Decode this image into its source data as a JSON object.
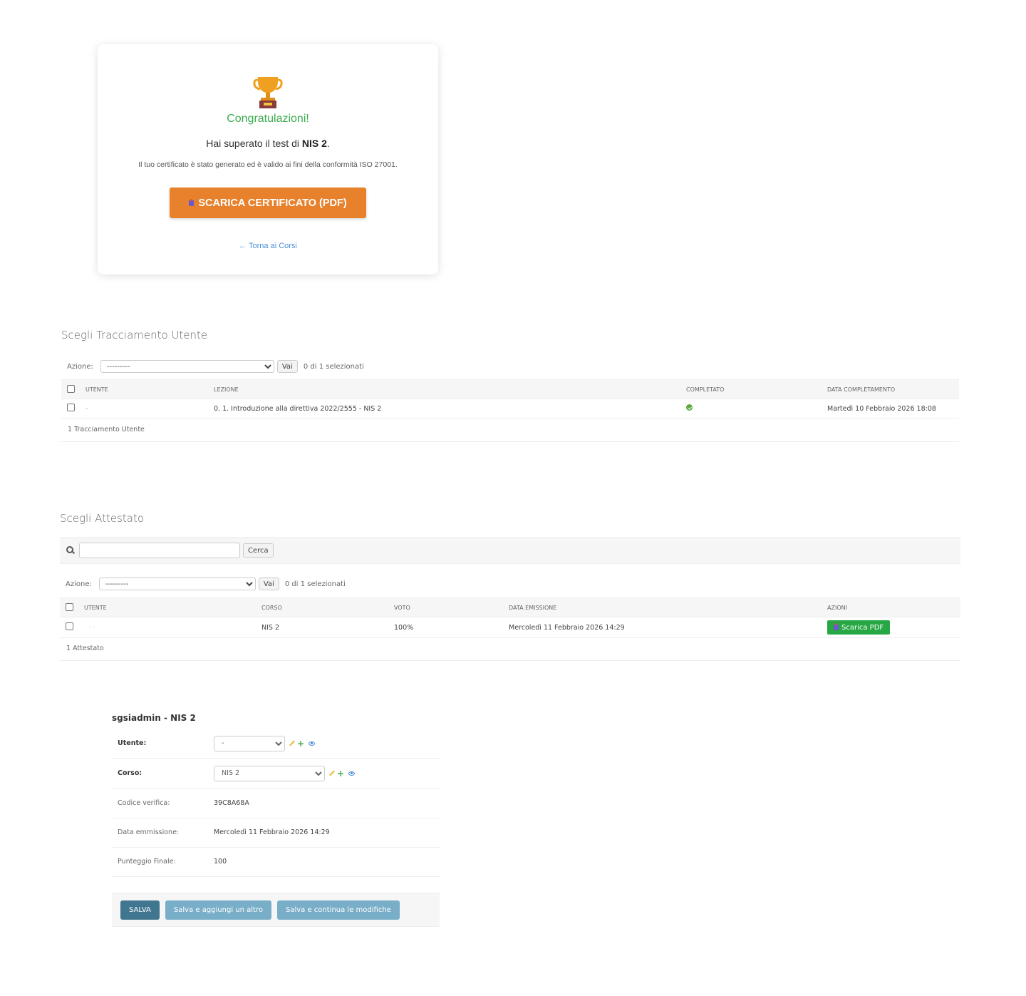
{
  "certificate": {
    "congrats": "Congratulazioni!",
    "passed_prefix": "Hai superato il test di ",
    "course": "NIS 2",
    "passed_suffix": ".",
    "validity": "Il tuo certificato è stato generato ed è valido ai fini della conformità ISO 27001.",
    "download_label": "SCARICA CERTIFICATO (PDF)",
    "back_label": "← Torna ai Corsi",
    "trophy_color": "#f0a020"
  },
  "tracking": {
    "title": "Scegli Tracciamento Utente",
    "action_label": "Azione:",
    "action_selected": "---------",
    "go_label": "Vai",
    "selected_count": "0 di 1 selezionati",
    "columns": [
      "Utente",
      "Lezione",
      "Completato",
      "Data completamento"
    ],
    "rows": [
      {
        "utente": "-",
        "lezione": "0. 1. Introduzione alla direttiva 2022/2555 - NIS 2",
        "completato": true,
        "data": "Martedì 10 Febbraio 2026 18:08"
      }
    ],
    "footer": "1 Tracciamento Utente"
  },
  "attestato": {
    "title": "Scegli Attestato",
    "search_value": "",
    "search_button": "Cerca",
    "action_label": "Azione:",
    "action_selected": "---------",
    "go_label": "Vai",
    "selected_count": "0 di 1 selezionati",
    "columns": [
      "Utente",
      "Corso",
      "Voto",
      "Data emissione",
      "Azioni"
    ],
    "rows": [
      {
        "utente": "· · · ·",
        "corso": "NIS 2",
        "voto": "100%",
        "data": "Mercoledì 11 Febbraio 2026 14:29",
        "azione": "Scarica PDF"
      }
    ],
    "footer": "1 Attestato"
  },
  "form": {
    "title": "sgsiadmin - NIS 2",
    "fields": {
      "utente": {
        "label": "Utente:",
        "value": "-"
      },
      "corso": {
        "label": "Corso:",
        "value": "NIS 2"
      },
      "codice": {
        "label": "Codice verifica:",
        "value": "39C8A68A"
      },
      "data": {
        "label": "Data emmissione:",
        "value": "Mercoledì 11 Febbraio 2026 14:29"
      },
      "punteggio": {
        "label": "Punteggio Finale:",
        "value": "100"
      }
    },
    "buttons": {
      "save": "SALVA",
      "save_add": "Salva e aggiungi un altro",
      "save_continue": "Salva e continua le modifiche"
    }
  }
}
